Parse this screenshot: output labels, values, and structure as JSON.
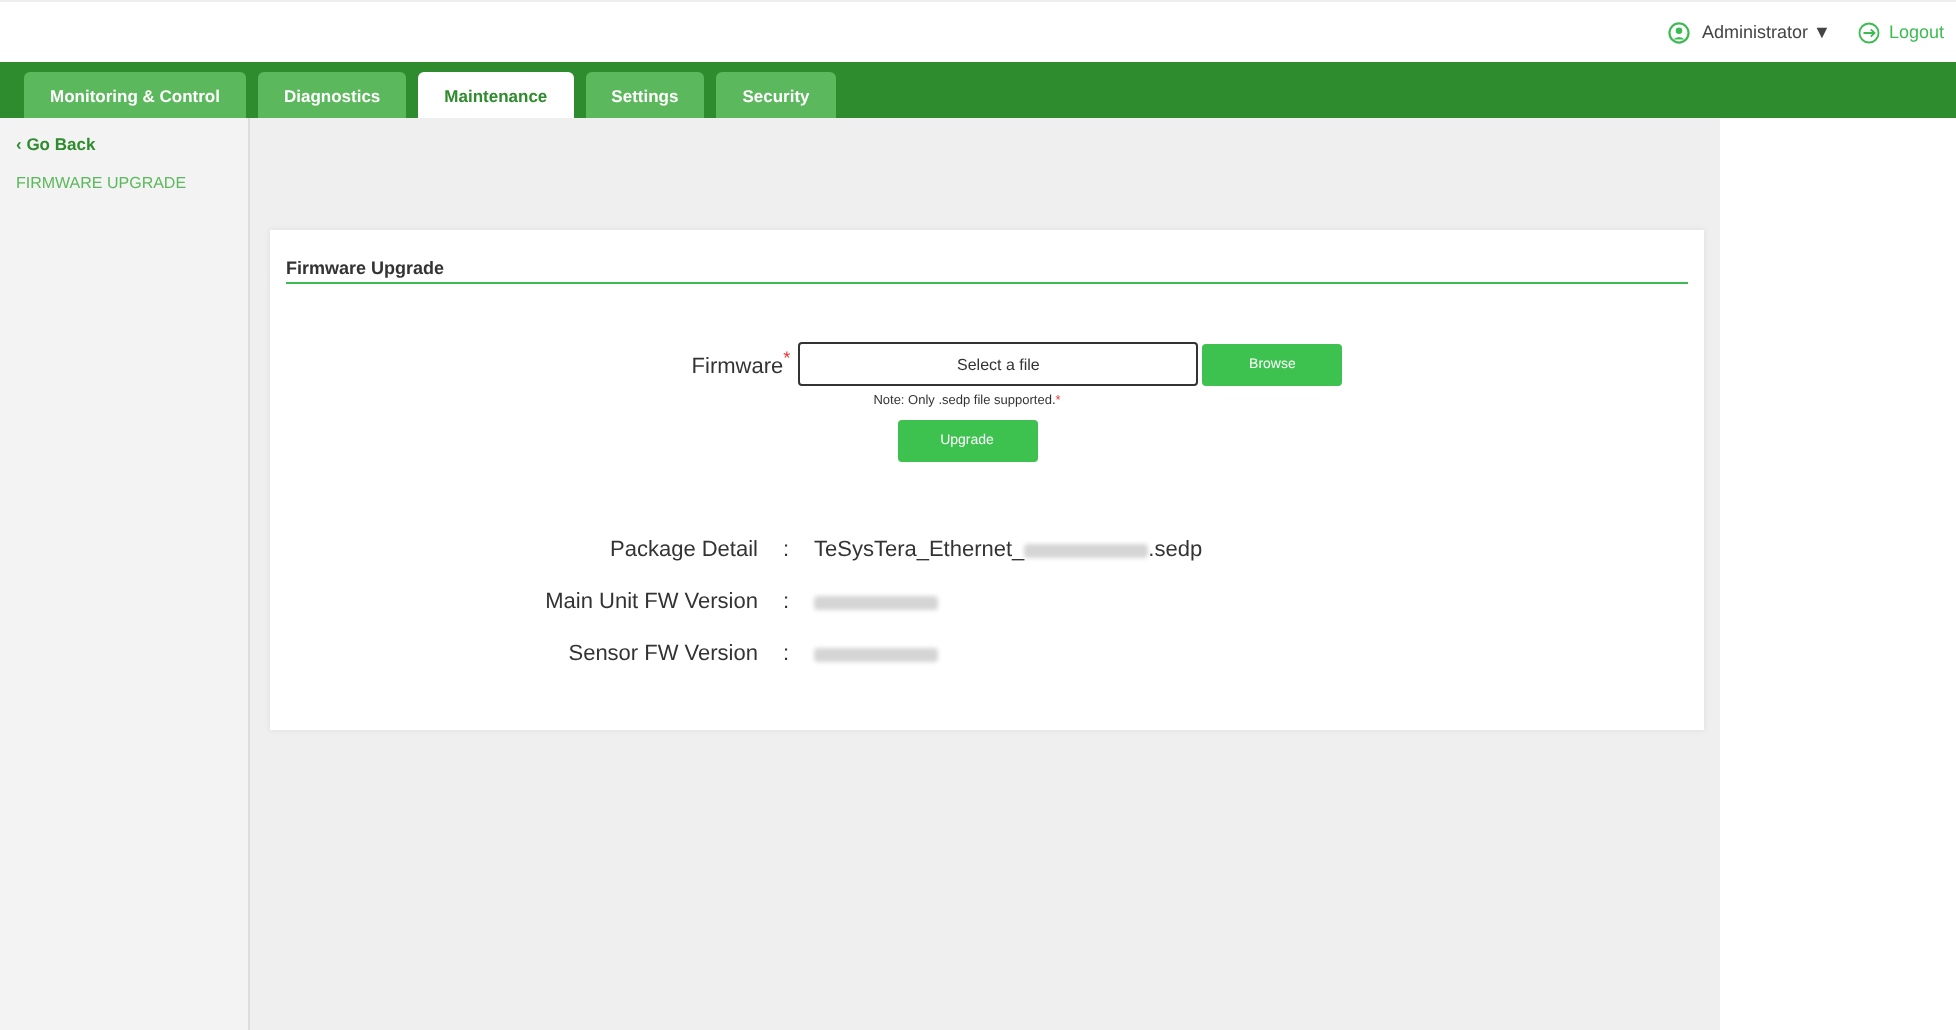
{
  "header": {
    "user": "Administrator ▼",
    "logout": "Logout"
  },
  "tabs": [
    {
      "label": "Monitoring & Control",
      "selected": false
    },
    {
      "label": "Diagnostics",
      "selected": false
    },
    {
      "label": "Maintenance",
      "selected": true
    },
    {
      "label": "Settings",
      "selected": false
    },
    {
      "label": "Security",
      "selected": false
    }
  ],
  "sidebar": {
    "back": "‹ Go Back",
    "items": [
      {
        "label": "FIRMWARE UPGRADE",
        "selected": false
      }
    ]
  },
  "card": {
    "title": "Firmware Upgrade",
    "firmware_label": "Firmware",
    "required_mark": "*",
    "file_placeholder": "Select a file",
    "browse": "Browse",
    "note": "Note: Only .sedp file supported.",
    "note_mark": "*",
    "upgrade": "Upgrade",
    "details": [
      {
        "label": "Package Detail",
        "prefix": "TeSysTera_Ethernet_",
        "suffix": ".sedp"
      },
      {
        "label": "Main Unit FW Version"
      },
      {
        "label": "Sensor FW Version"
      }
    ],
    "separator": ":"
  }
}
